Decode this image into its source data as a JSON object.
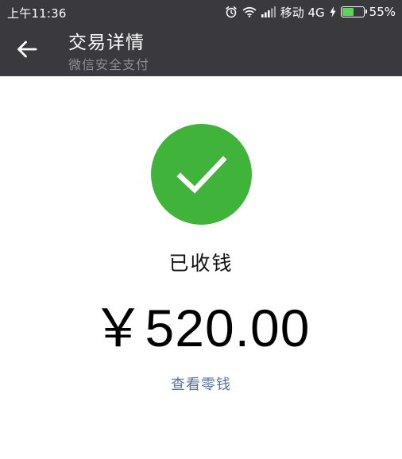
{
  "status_bar": {
    "time": "上午11:36",
    "carrier": "移动 4G",
    "battery_percent": "55%",
    "battery_level": 0.55,
    "icons": [
      "alarm-icon",
      "wifi-icon",
      "signal-icon",
      "charging-icon",
      "battery-icon"
    ]
  },
  "header": {
    "back_icon": "arrow-left-icon",
    "title": "交易详情",
    "subtitle": "微信安全支付"
  },
  "main": {
    "status_icon": "check-icon",
    "status_text": "已收钱",
    "amount": "￥520.00",
    "link_text": "查看零钱"
  },
  "colors": {
    "header_bg": "#3a393e",
    "success_green": "#3fb33a",
    "link_blue": "#5b7099",
    "battery_green": "#5fd35a"
  }
}
